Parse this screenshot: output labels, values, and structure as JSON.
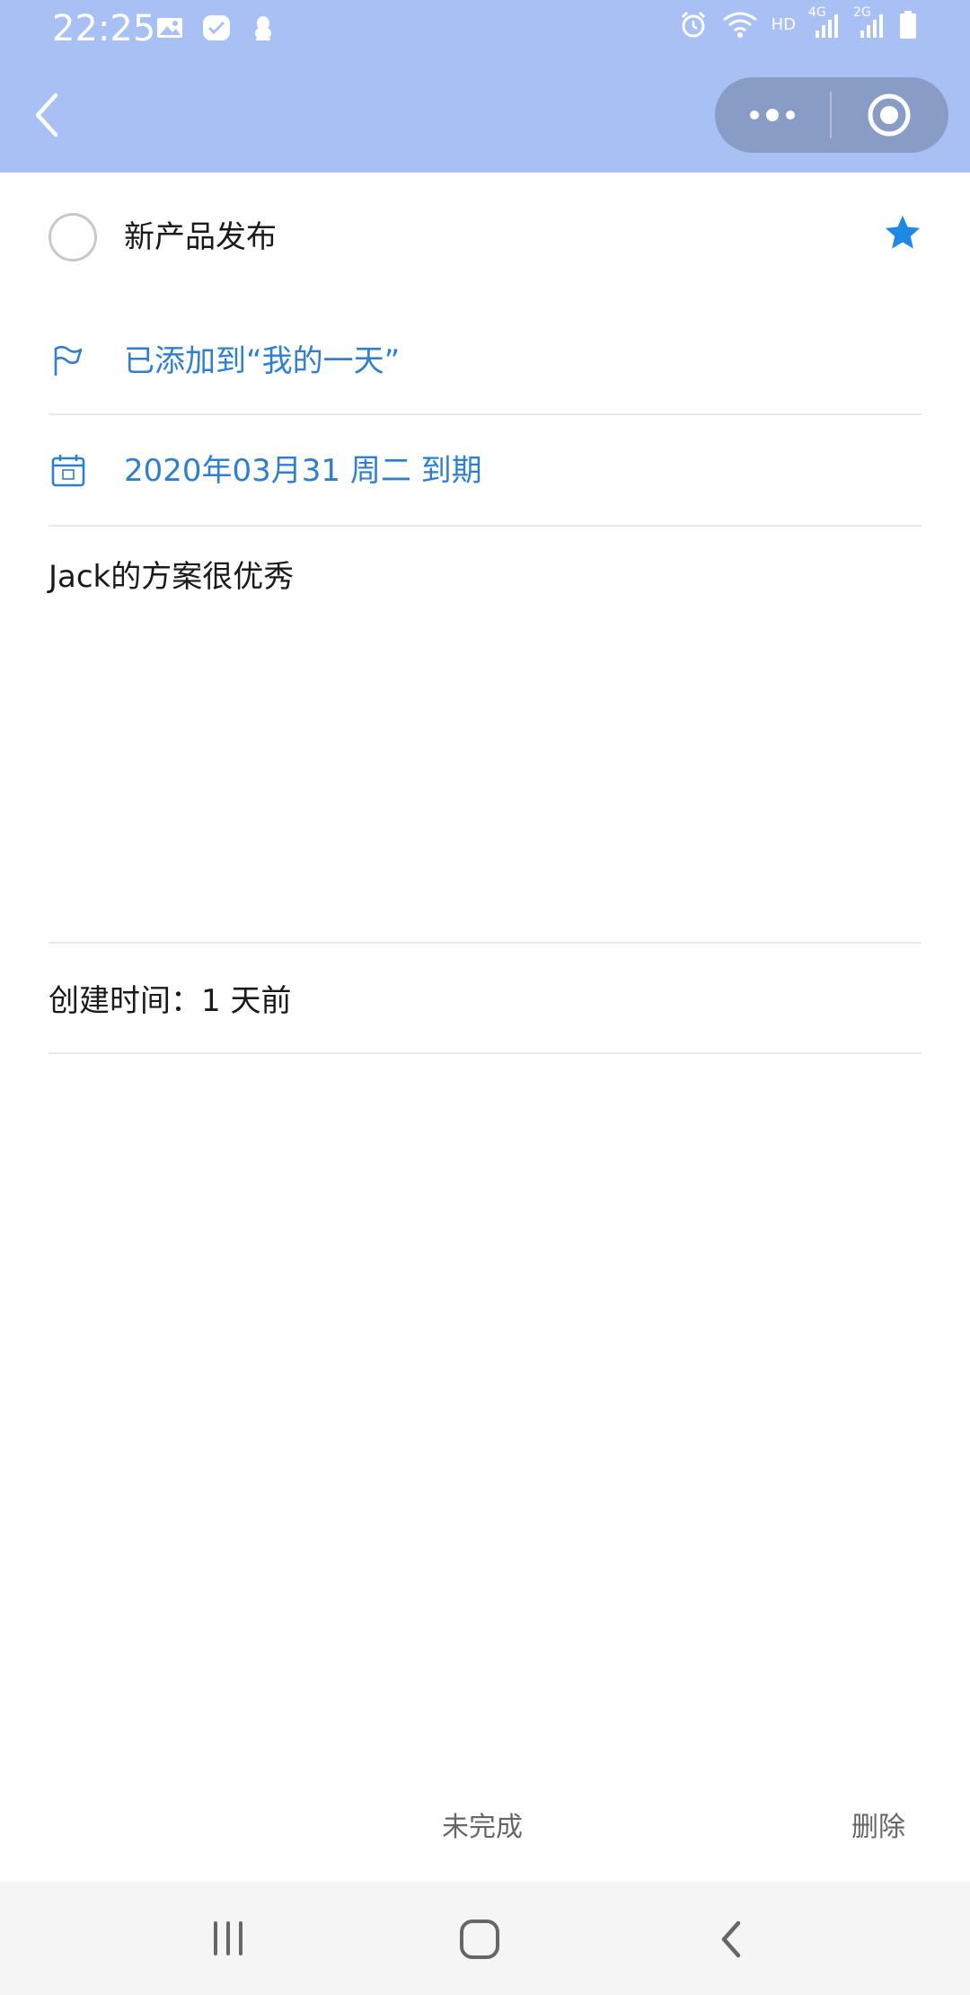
{
  "status_bar": {
    "time": "22:25",
    "network_hd": "HD",
    "network_4g": "4G",
    "network_2g": "2G"
  },
  "task": {
    "title": "新产品发布",
    "starred": true
  },
  "my_day": {
    "label": "已添加到“我的一天”"
  },
  "due_date": {
    "label": "2020年03月31 周二 到期"
  },
  "note": {
    "text": "Jack的方案很优秀"
  },
  "created": {
    "text": "创建时间：1 天前"
  },
  "actions": {
    "incomplete_label": "未完成",
    "delete_label": "删除"
  },
  "colors": {
    "header_bg": "#a8c0f4",
    "accent": "#2f7fd0",
    "star": "#1e88e5"
  }
}
